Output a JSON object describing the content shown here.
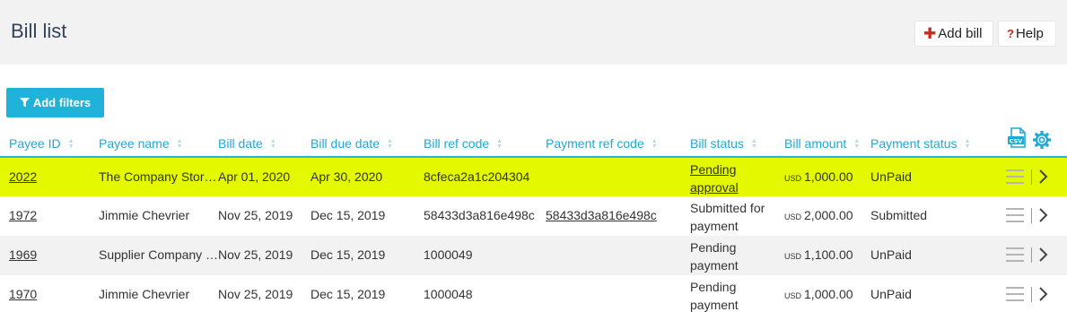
{
  "header": {
    "title": "Bill list",
    "add_bill_label": "Add bill",
    "help_label": "Help"
  },
  "filters": {
    "add_filters_label": "Add filters"
  },
  "table": {
    "columns": [
      "Payee ID",
      "Payee name",
      "Bill date",
      "Bill due date",
      "Bill ref code",
      "Payment ref code",
      "Bill status",
      "Bill amount",
      "Payment status"
    ],
    "rows": [
      {
        "payee_id": "2022",
        "payee_name": "The Company Stor…",
        "bill_date": "Apr 01, 2020",
        "due_date": "Apr 30, 2020",
        "bill_ref": "8cfeca2a1c204304",
        "payment_ref": "",
        "status_line1": "Pending",
        "status_line2": "approval",
        "currency": "USD",
        "amount": "1,000.00",
        "payment_status": "UnPaid"
      },
      {
        "payee_id": "1972",
        "payee_name": "Jimmie Chevrier",
        "bill_date": "Nov 25, 2019",
        "due_date": "Dec 15, 2019",
        "bill_ref": "58433d3a816e498c",
        "payment_ref": "58433d3a816e498c",
        "status_line1": "Submitted for",
        "status_line2": "payment",
        "currency": "USD",
        "amount": "2,000.00",
        "payment_status": "Submitted"
      },
      {
        "payee_id": "1969",
        "payee_name": "Supplier Company …",
        "bill_date": "Nov 25, 2019",
        "due_date": "Dec 15, 2019",
        "bill_ref": "1000049",
        "payment_ref": "",
        "status_line1": "Pending",
        "status_line2": "payment",
        "currency": "USD",
        "amount": "1,100.00",
        "payment_status": "UnPaid"
      },
      {
        "payee_id": "1970",
        "payee_name": "Jimmie Chevrier",
        "bill_date": "Nov 25, 2019",
        "due_date": "Dec 15, 2019",
        "bill_ref": "1000048",
        "payment_ref": "",
        "status_line1": "Pending",
        "status_line2": "payment",
        "currency": "USD",
        "amount": "1,000.00",
        "payment_status": "UnPaid"
      }
    ]
  },
  "icons": {
    "csv": "csv-export-icon",
    "settings": "gear-icon",
    "row_menu": "hamburger-menu-icon",
    "row_open": "chevron-right-icon",
    "filter": "filter-icon"
  },
  "colors": {
    "accent": "#1fb3d9",
    "highlight_row": "#e4f800",
    "danger": "#d0261b"
  }
}
